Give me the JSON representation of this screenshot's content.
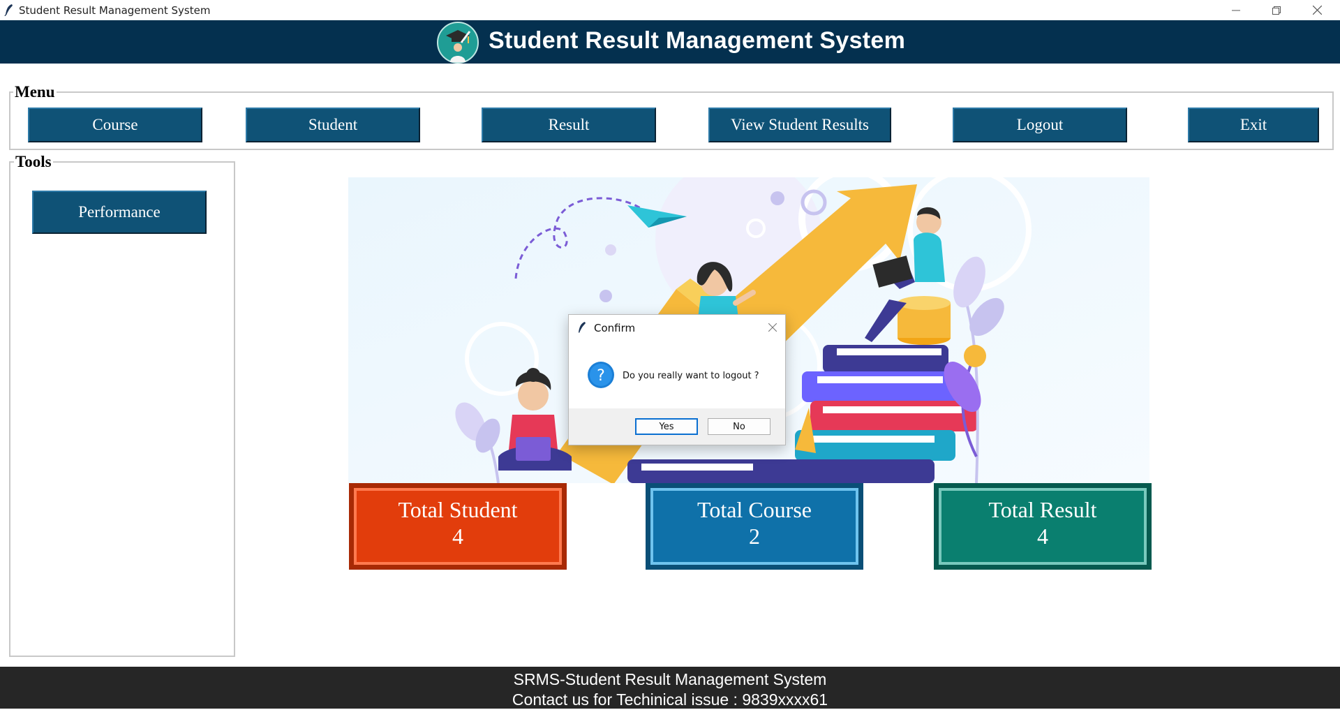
{
  "window": {
    "title": "Student Result Management System"
  },
  "header": {
    "title": "Student Result Management System"
  },
  "menu": {
    "label": "Menu",
    "buttons": [
      "Course",
      "Student",
      "Result",
      "View Student Results",
      "Logout",
      "Exit"
    ]
  },
  "tools": {
    "label": "Tools",
    "buttons": [
      "Performance"
    ]
  },
  "stats": [
    {
      "label": "Total Student",
      "value": "4",
      "color": "#e23d0c"
    },
    {
      "label": "Total Course",
      "value": "2",
      "color": "#0f71a9"
    },
    {
      "label": "Total Result",
      "value": "4",
      "color": "#0a7f6f"
    }
  ],
  "dialog": {
    "title": "Confirm",
    "message": "Do you really want to logout ?",
    "yes": "Yes",
    "no": "No"
  },
  "footer": {
    "line1": "SRMS-Student Result Management System",
    "line2": "Contact us for Techinical issue : 9839xxxx61"
  },
  "colors": {
    "header_bg": "#04304f",
    "button_bg": "#0f5276",
    "footer_bg": "#262626"
  }
}
